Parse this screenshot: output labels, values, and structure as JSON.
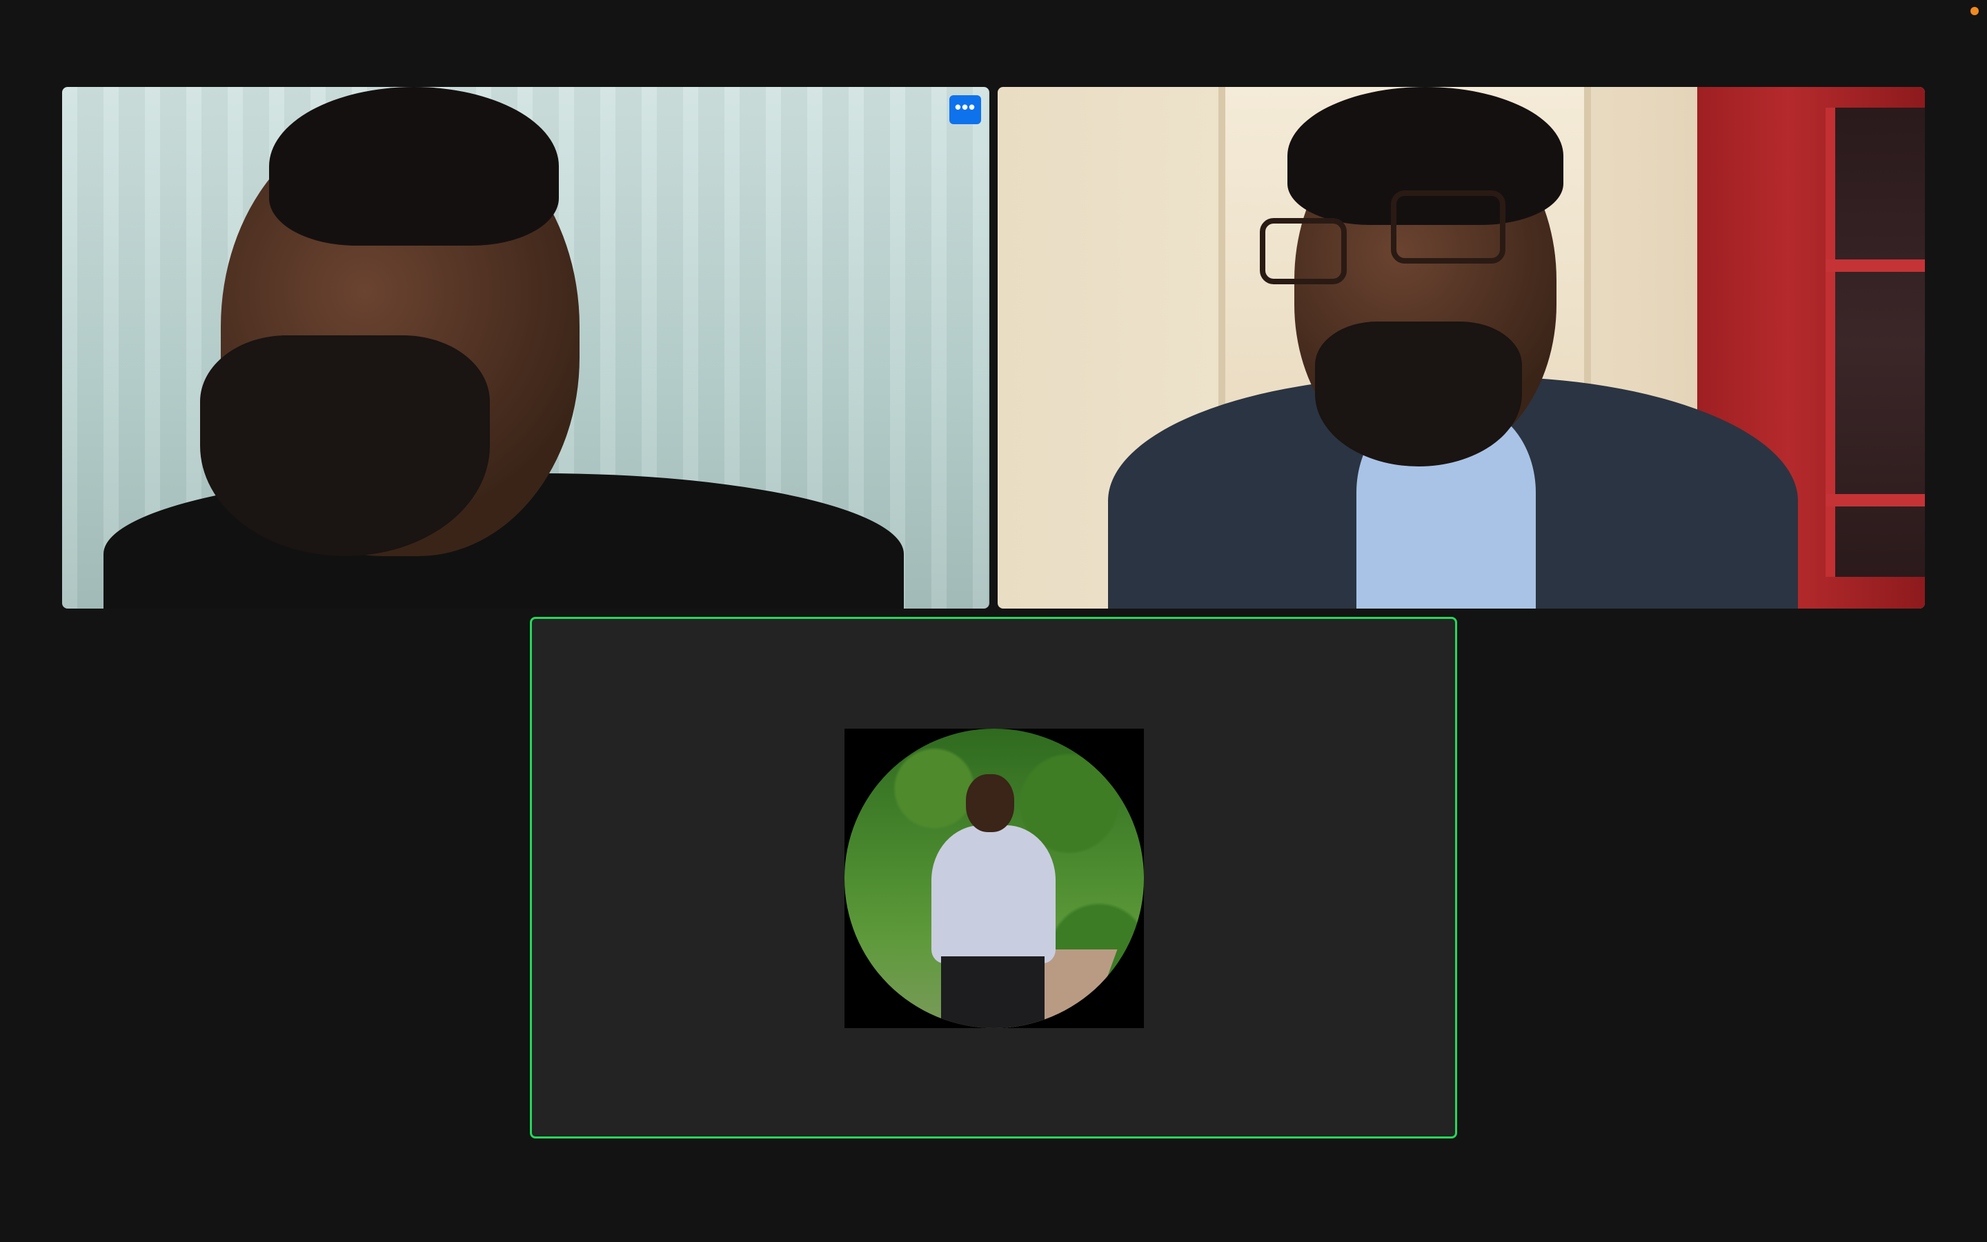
{
  "meeting": {
    "participants": [
      {
        "id": "participant-1",
        "video_on": true,
        "speaking": false
      },
      {
        "id": "participant-2",
        "video_on": true,
        "speaking": false
      },
      {
        "id": "participant-3",
        "video_on": false,
        "speaking": true,
        "shows_profile_picture": true
      }
    ],
    "more_options_icon": "ellipsis-horizontal-icon",
    "colors": {
      "background": "#131313",
      "tile_background": "#232323",
      "active_speaker_border": "#23d959",
      "button_blue": "#0e72ed",
      "indicator_orange": "#f28a1d"
    }
  },
  "controls": {
    "more_button_glyph": "•••"
  }
}
